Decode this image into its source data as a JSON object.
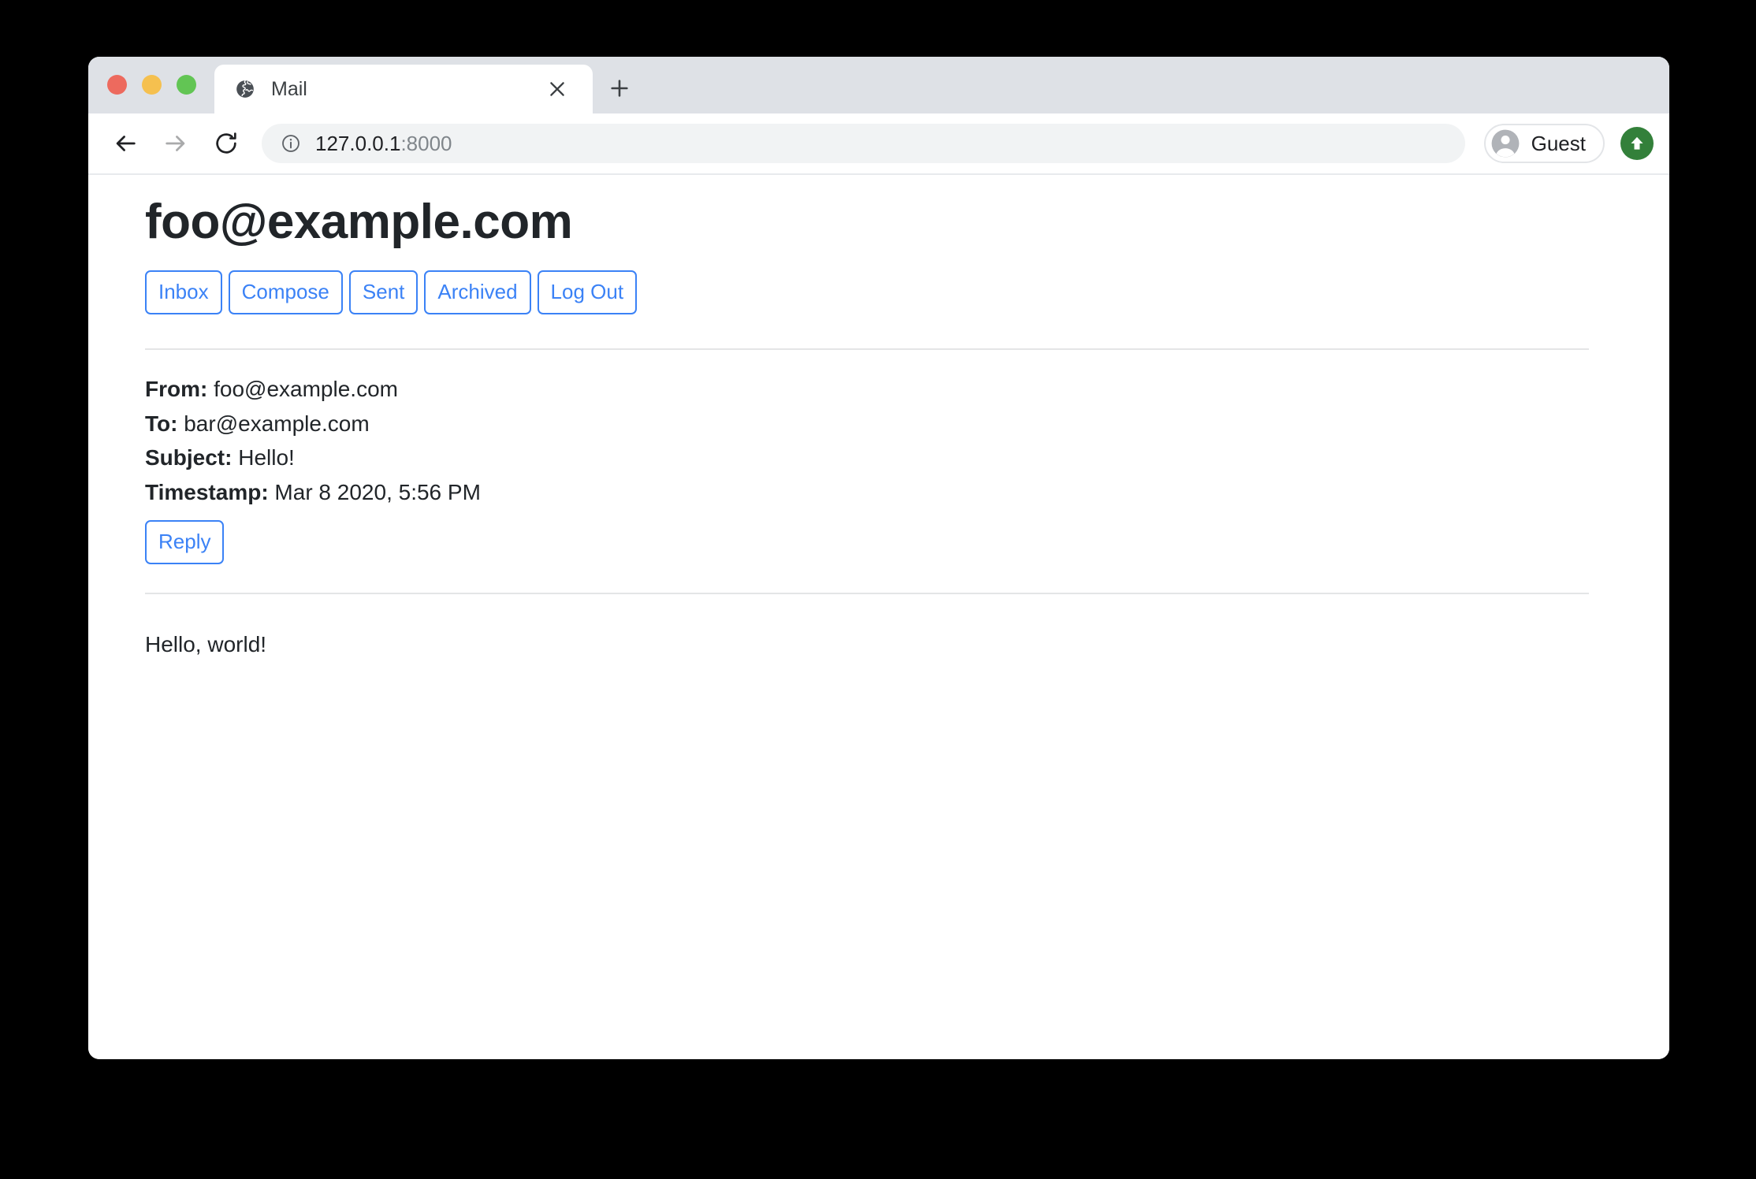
{
  "browser": {
    "traffic_lights": {
      "close_label": "close-window",
      "minimize_label": "minimize-window",
      "maximize_label": "maximize-window",
      "close_color": "#ed6a5e",
      "minimize_color": "#f5c04f",
      "maximize_color": "#62c554"
    },
    "tab": {
      "title": "Mail",
      "favicon": "globe-icon",
      "close_icon": "close-icon"
    },
    "new_tab_icon": "plus-icon",
    "toolbar": {
      "back_icon": "arrow-left-icon",
      "forward_icon": "arrow-right-icon",
      "reload_icon": "reload-icon",
      "site_info_icon": "info-icon",
      "url_host": "127.0.0.1",
      "url_port": ":8000",
      "url_full": "127.0.0.1:8000",
      "profile_name": "Guest",
      "profile_avatar_icon": "account-circle-icon",
      "update_icon": "arrow-up-icon",
      "update_color": "#33803a"
    }
  },
  "page": {
    "title": "foo@example.com",
    "nav": [
      {
        "label": "Inbox",
        "name": "nav-inbox"
      },
      {
        "label": "Compose",
        "name": "nav-compose"
      },
      {
        "label": "Sent",
        "name": "nav-sent"
      },
      {
        "label": "Archived",
        "name": "nav-archived"
      },
      {
        "label": "Log Out",
        "name": "nav-log-out"
      }
    ],
    "email": {
      "from_label": "From:",
      "from_value": "foo@example.com",
      "to_label": "To:",
      "to_value": "bar@example.com",
      "subject_label": "Subject:",
      "subject_value": "Hello!",
      "timestamp_label": "Timestamp:",
      "timestamp_value": "Mar 8 2020, 5:56 PM",
      "reply_label": "Reply",
      "body": "Hello, world!"
    },
    "accent_color": "#3b82f6"
  }
}
